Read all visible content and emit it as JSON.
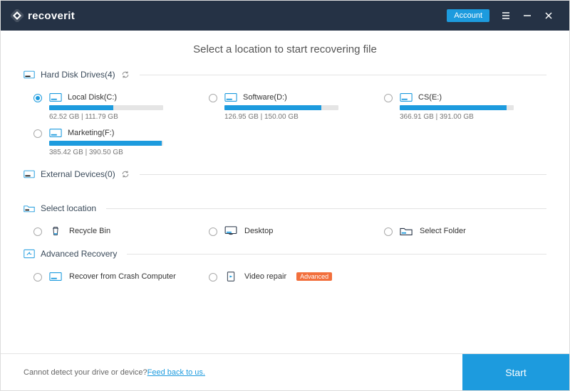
{
  "app": {
    "name": "recoverit"
  },
  "titlebar": {
    "account": "Account"
  },
  "heading": "Select a location to start recovering file",
  "sections": {
    "hdd": {
      "label": "Hard Disk Drives(4)"
    },
    "external": {
      "label": "External Devices(0)"
    },
    "select_location": {
      "label": "Select location"
    },
    "advanced": {
      "label": "Advanced Recovery"
    }
  },
  "drives": [
    {
      "name": "Local Disk(C:)",
      "used": 62.52,
      "total": 111.79,
      "size_text": "62.52  GB | 111.79  GB",
      "selected": true
    },
    {
      "name": "Software(D:)",
      "used": 126.95,
      "total": 150.0,
      "size_text": "126.95  GB | 150.00  GB",
      "selected": false
    },
    {
      "name": "CS(E:)",
      "used": 366.91,
      "total": 391.0,
      "size_text": "366.91  GB | 391.00  GB",
      "selected": false
    },
    {
      "name": "Marketing(F:)",
      "used": 385.42,
      "total": 390.5,
      "size_text": "385.42  GB | 390.50  GB",
      "selected": false
    }
  ],
  "locations": [
    {
      "name": "Recycle Bin"
    },
    {
      "name": "Desktop"
    },
    {
      "name": "Select Folder"
    }
  ],
  "advanced_items": [
    {
      "name": "Recover from Crash Computer",
      "badge": ""
    },
    {
      "name": "Video repair",
      "badge": "Advanced"
    }
  ],
  "footer": {
    "text": "Cannot detect your drive or device? ",
    "link": "Feed back to us.",
    "start": "Start"
  },
  "colors": {
    "accent": "#1d9bde",
    "header": "#253245",
    "badge": "#f26f3c"
  }
}
